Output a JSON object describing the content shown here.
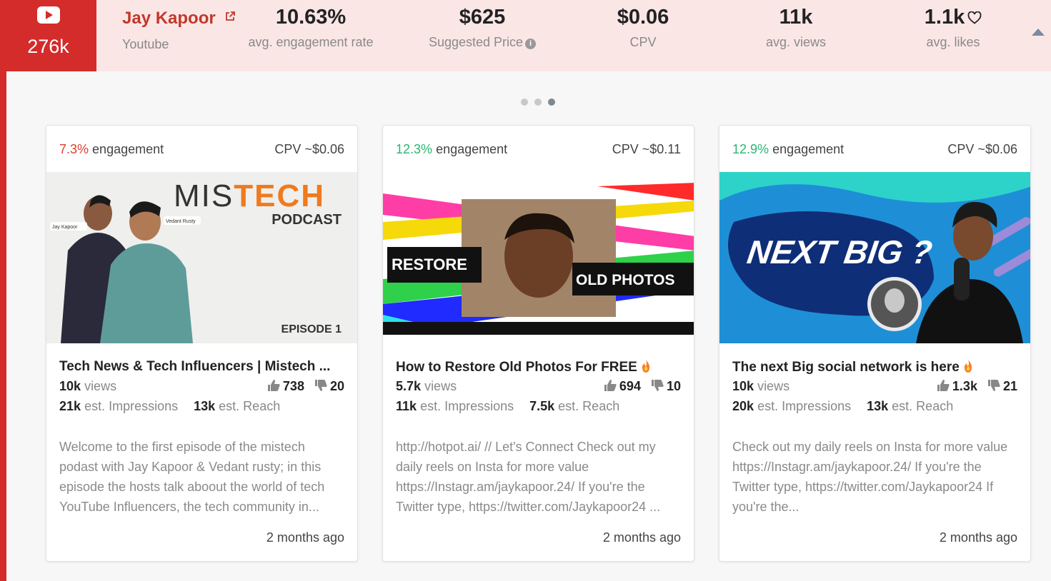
{
  "header": {
    "subscribers": "276k",
    "creator_name": "Jay Kapoor",
    "platform": "Youtube",
    "stats": [
      {
        "value": "10.63%",
        "label": "avg. engagement rate"
      },
      {
        "value": "$625",
        "label": "Suggested Price"
      },
      {
        "value": "$0.06",
        "label": "CPV"
      },
      {
        "value": "11k",
        "label": "avg. views"
      },
      {
        "value": "1.1k",
        "label": "avg. likes"
      }
    ]
  },
  "carousel": {
    "pages": 3,
    "active_page": 3
  },
  "engagement_word": "engagement",
  "cards": [
    {
      "engagement": "7.3%",
      "cpv": "CPV ~$0.06",
      "thumbnail": {
        "brand_a": "MIS",
        "brand_b": "TECH",
        "sub": "PODCAST",
        "episode": "EPISODE 1",
        "tag1": "Jay Kapoor",
        "tag2": "Vedant Rusty"
      },
      "title": "Tech News & Tech Influencers | Mistech ...",
      "views": "10k",
      "views_label": "views",
      "likes": "738",
      "dislikes": "20",
      "impressions": "21k",
      "impressions_label": "est. Impressions",
      "reach": "13k",
      "reach_label": "est. Reach",
      "description": "Welcome to the first episode of the mistech podast with Jay Kapoor & Vedant rusty; in this episode the hosts talk aboout the world of tech YouTube Influencers, the tech community in...",
      "date": "2 months ago"
    },
    {
      "engagement": "12.3%",
      "cpv": "CPV ~$0.11",
      "thumbnail": {
        "left_label": "RESTORE",
        "right_label": "OLD PHOTOS"
      },
      "title": "How to Restore Old Photos For FREE",
      "views": "5.7k",
      "views_label": "views",
      "likes": "694",
      "dislikes": "10",
      "impressions": "11k",
      "impressions_label": "est. Impressions",
      "reach": "7.5k",
      "reach_label": "est. Reach",
      "description": "http://hotpot.ai/ // Let's Connect Check out my daily reels on Insta for more value https://Instagr.am/jaykapoor.24/ If you're the Twitter type, https://twitter.com/Jaykapoor24 ...",
      "date": "2 months ago"
    },
    {
      "engagement": "12.9%",
      "cpv": "CPV ~$0.06",
      "thumbnail": {
        "headline": "NEXT BIG ?"
      },
      "title": "The next Big social network is here",
      "views": "10k",
      "views_label": "views",
      "likes": "1.3k",
      "dislikes": "21",
      "impressions": "20k",
      "impressions_label": "est. Impressions",
      "reach": "13k",
      "reach_label": "est. Reach",
      "description": "Check out my daily reels on Insta for more value https://Instagr.am/jaykapoor.24/ If you're the Twitter type, https://twitter.com/Jaykapoor24 If you're the...",
      "date": "2 months ago"
    }
  ],
  "colors": {
    "brand_red": "#d42b2b",
    "header_bg": "#fbe6e6",
    "engagement_low": "#d9412f",
    "engagement_high": "#2bb673"
  }
}
